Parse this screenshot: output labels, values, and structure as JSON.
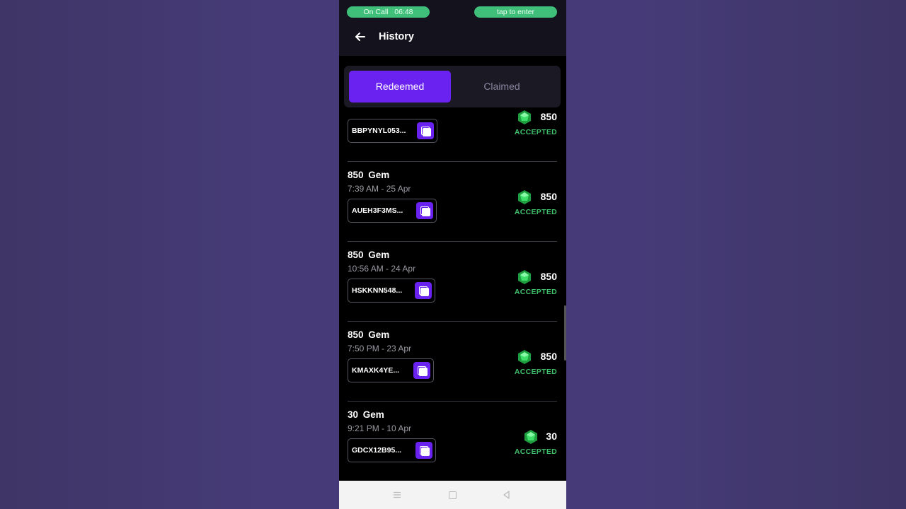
{
  "status_bar": {
    "call_label": "On Call   06:48",
    "enter_label": "tap to enter"
  },
  "header": {
    "title": "History"
  },
  "tabs": [
    {
      "label": "Redeemed",
      "active": true
    },
    {
      "label": "Claimed",
      "active": false
    }
  ],
  "icons": {
    "back": "arrow-left-icon",
    "copy": "copy-icon",
    "gem": "gem-icon"
  },
  "colors": {
    "accent": "#6a22f0",
    "accepted": "#3fbf6a",
    "call_pill": "#3fbf7a"
  },
  "history": [
    {
      "title": "",
      "date": "",
      "code": "BBPYNYL053...",
      "amount": "850",
      "status": "ACCEPTED"
    },
    {
      "title": "850  Gem",
      "date": "7:39 AM - 25 Apr",
      "code": "AUEH3F3MS...",
      "amount": "850",
      "status": "ACCEPTED"
    },
    {
      "title": "850  Gem",
      "date": "10:56 AM - 24 Apr",
      "code": "HSKKNN548...",
      "amount": "850",
      "status": "ACCEPTED"
    },
    {
      "title": "850  Gem",
      "date": "7:50 PM - 23 Apr",
      "code": "KMAXK4YE...",
      "amount": "850",
      "status": "ACCEPTED"
    },
    {
      "title": "30  Gem",
      "date": "9:21 PM - 10 Apr",
      "code": "GDCX12B95...",
      "amount": "30",
      "status": "ACCEPTED"
    }
  ]
}
